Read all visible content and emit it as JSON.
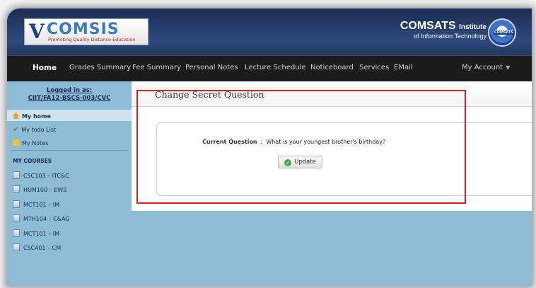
{
  "header": {
    "logo_letter": "V",
    "logo_name": "COMSIS",
    "logo_tagline": "Promoting Quality Distance Education",
    "institute_name": "COMSATS",
    "institute_suffix": "Institute",
    "institute_line2": "of Information Technology",
    "seal_text": "COMSATS"
  },
  "nav": {
    "items": [
      "Home",
      "Grades Summary",
      "Fee Summary",
      "Personal Notes",
      "Lecture Schedule",
      "Noticeboard",
      "Services",
      "EMail"
    ],
    "account": "My Account"
  },
  "sidebar": {
    "logged_label": "Logged in as:",
    "user_id": "CIIT/FA12-BSCS-003/CVC",
    "menu": [
      "My home",
      "My todo List",
      "My Notes"
    ],
    "courses_heading": "MY COURSES",
    "courses": [
      "CSC103 – ITC&C",
      "HUM100 – EWS",
      "MCT101 – IM",
      "MTH104 – C&AG",
      "MCT101 – IM",
      "CSC401 – CM"
    ]
  },
  "main": {
    "title": "Change Secret Question",
    "question_label": "Current Question",
    "question_sep": ":",
    "question_value": "What is your youngest brother's birthday?",
    "update_label": "Update"
  },
  "colors": {
    "highlight": "#e02020",
    "nav_bg": "#1c1c1c",
    "sidebar_bg": "#8dbdd6"
  }
}
